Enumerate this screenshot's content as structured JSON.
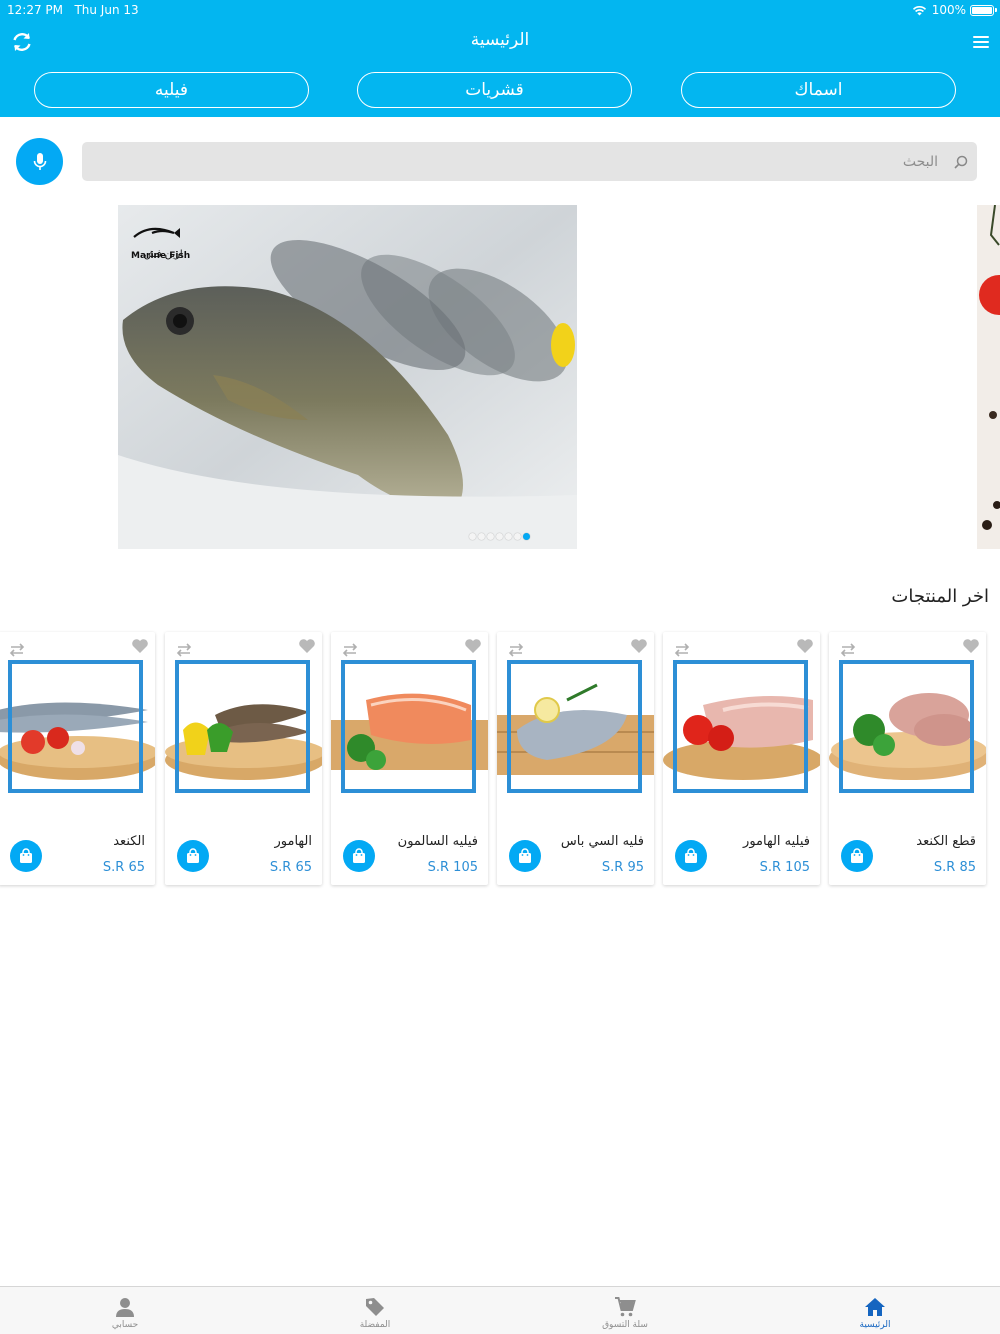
{
  "status_bar": {
    "time": "12:27 PM",
    "date": "Thu Jun 13",
    "battery": "100%"
  },
  "header": {
    "title": "الرئيسية",
    "refresh_icon": "refresh-icon",
    "menu_icon": "hamburger-icon"
  },
  "categories": [
    "فيليه",
    "قشريات",
    "اسماك"
  ],
  "search": {
    "placeholder": "البحث"
  },
  "banner": {
    "logo_text": "Marine Fish",
    "slides": 7,
    "active_slide": 7
  },
  "latest": {
    "title": "اخر المنتجات",
    "products": [
      {
        "name": "الكنعد",
        "price": "S.R 65"
      },
      {
        "name": "الهامور",
        "price": "S.R 65"
      },
      {
        "name": "فيليه السالمون",
        "price": "S.R 105"
      },
      {
        "name": "فليه السي باس",
        "price": "S.R 95"
      },
      {
        "name": "فيليه الهامور",
        "price": "S.R 105"
      },
      {
        "name": "قطع الكنعد",
        "price": "S.R 85"
      }
    ]
  },
  "tabbar": {
    "account": "حسابي",
    "favorites": "المفضلة",
    "cart": "سلة التسوق",
    "home": "الرئيسية"
  },
  "colors": {
    "primary": "#03b6f0",
    "accent": "#2d8fd6",
    "active_tab": "#1565c0"
  }
}
